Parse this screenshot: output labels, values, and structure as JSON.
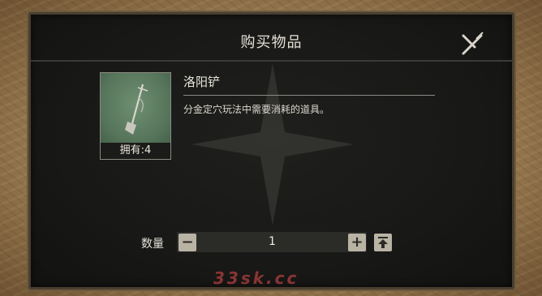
{
  "dialog": {
    "title": "购买物品",
    "close_icon": "close-cross-icon"
  },
  "item": {
    "name": "洛阳铲",
    "owned_text": "拥有:4",
    "description": "分金定穴玩法中需要消耗的道具。",
    "icon": "luoyang-shovel-icon"
  },
  "quantity": {
    "label": "数量",
    "value": "1",
    "minus_label": "−",
    "plus_label": "+",
    "max_icon": "max-arrow-icon"
  },
  "watermark": {
    "text": "33sk.cc"
  },
  "colors": {
    "panel_bg": "#181817",
    "frame": "#9c7e52",
    "button_bg": "#b9b3a4",
    "item_bg": "#5a7a5e"
  }
}
